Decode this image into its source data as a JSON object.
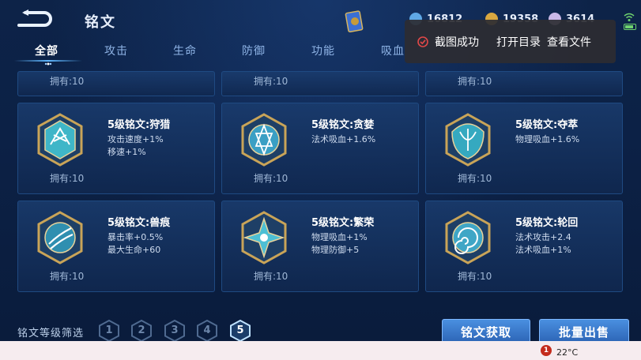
{
  "header": {
    "title": "铭文",
    "currencies": [
      {
        "value": "16812",
        "color": "#5fa8e6"
      },
      {
        "value": "19358",
        "color": "#d8a740"
      },
      {
        "value": "3614",
        "color": "#c9b8e8"
      }
    ]
  },
  "tabs": [
    {
      "label": "全部",
      "active": true
    },
    {
      "label": "攻击"
    },
    {
      "label": "生命"
    },
    {
      "label": "防御"
    },
    {
      "label": "功能"
    },
    {
      "label": "吸血"
    }
  ],
  "top_row_owned": [
    "拥有:10",
    "拥有:10",
    "拥有:10"
  ],
  "cards": [
    {
      "title": "5级铭文:狩猎",
      "stats": [
        "攻击速度+1%",
        "移速+1%"
      ],
      "owned": "拥有:10",
      "icon": "hunt-emblem-icon"
    },
    {
      "title": "5级铭文:贪婪",
      "stats": [
        "法术吸血+1.6%"
      ],
      "owned": "拥有:10",
      "icon": "greed-emblem-icon"
    },
    {
      "title": "5级铭文:夺萃",
      "stats": [
        "物理吸血+1.6%"
      ],
      "owned": "拥有:10",
      "icon": "seize-emblem-icon"
    },
    {
      "title": "5级铭文:兽痕",
      "stats": [
        "暴击率+0.5%",
        "最大生命+60"
      ],
      "owned": "拥有:10",
      "icon": "beast-mark-emblem-icon"
    },
    {
      "title": "5级铭文:繁荣",
      "stats": [
        "物理吸血+1%",
        "物理防御+5"
      ],
      "owned": "拥有:10",
      "icon": "prosperity-emblem-icon"
    },
    {
      "title": "5级铭文:轮回",
      "stats": [
        "法术攻击+2.4",
        "法术吸血+1%"
      ],
      "owned": "拥有:10",
      "icon": "reincarnation-emblem-icon"
    }
  ],
  "footer": {
    "filter_label": "铭文等级筛选",
    "levels": [
      "1",
      "2",
      "3",
      "4",
      "5"
    ],
    "active_level": "5",
    "obtain_button": "铭文获取",
    "bulk_sell_button": "批量出售"
  },
  "toast": {
    "message": "截图成功",
    "open_folder": "打开目录",
    "view_file": "查看文件"
  },
  "taskbar": {
    "weather_badge": "1",
    "temperature": "22°C"
  }
}
